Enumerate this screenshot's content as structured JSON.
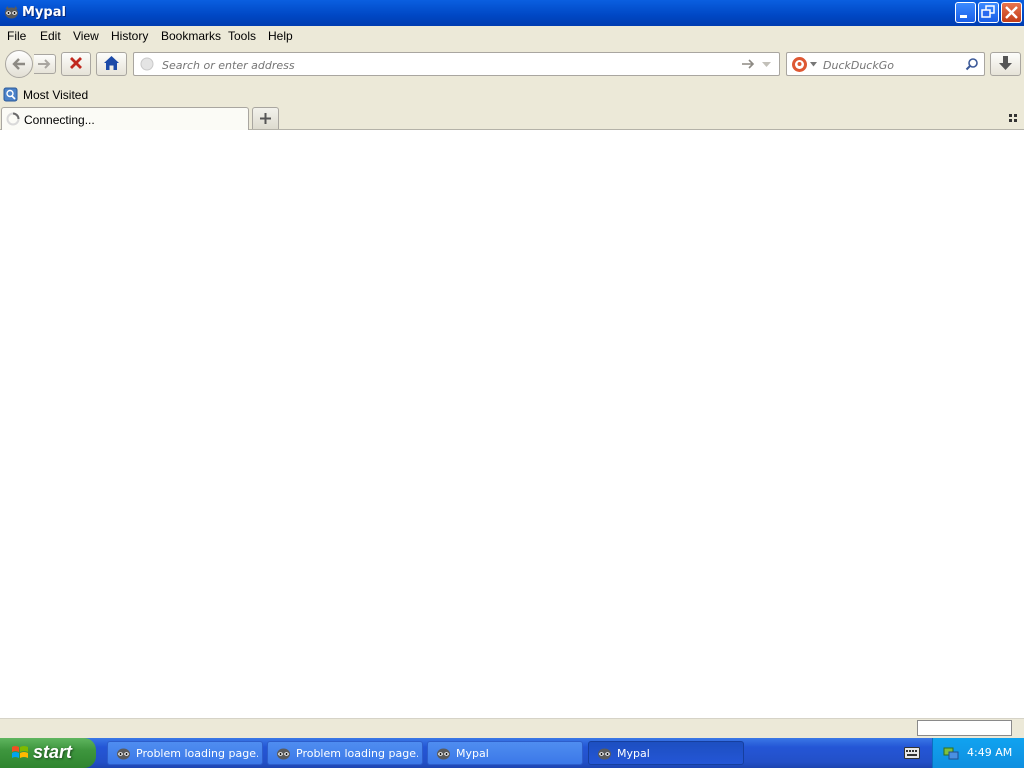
{
  "window": {
    "title": "Mypal",
    "icon": "raccoon-app-icon",
    "controls": {
      "minimize": "minimize-icon",
      "restore": "restore-icon",
      "close": "close-icon"
    }
  },
  "menubar": {
    "items": [
      {
        "label": "File"
      },
      {
        "label": "Edit"
      },
      {
        "label": "View"
      },
      {
        "label": "History"
      },
      {
        "label": "Bookmarks"
      },
      {
        "label": "Tools"
      },
      {
        "label": "Help"
      }
    ]
  },
  "toolbar": {
    "back_icon": "back-arrow-icon",
    "forward_icon": "forward-arrow-icon",
    "stop_icon": "stop-x-icon",
    "home_icon": "home-icon",
    "url_placeholder": "Search or enter address",
    "go_icon": "go-arrow-icon",
    "history_dropdown_icon": "dropdown-triangle-icon",
    "search_engine": "DuckDuckGo",
    "search_placeholder": "DuckDuckGo",
    "search_icon": "magnifier-icon",
    "downloads_icon": "download-arrow-icon"
  },
  "bookmarks": {
    "items": [
      {
        "label": "Most Visited",
        "icon": "bookmarks-folder-icon"
      }
    ]
  },
  "tabs": {
    "items": [
      {
        "label": "Connecting...",
        "icon": "loading-spinner-icon"
      }
    ],
    "new_tab_icon": "plus-icon",
    "list_all_icon": "grid-icon"
  },
  "taskbar": {
    "start_label": "start",
    "tasks": [
      {
        "label": "Problem loading page..."
      },
      {
        "label": "Problem loading page..."
      },
      {
        "label": "Mypal"
      },
      {
        "label": "Mypal"
      }
    ],
    "clock": "4:49 AM"
  },
  "colors": {
    "titlebar": "#0047c4",
    "chrome": "#ece9d8",
    "start_green": "#3e963e",
    "taskbar_blue": "#2456d6",
    "stop_red": "#c0281e",
    "home_blue": "#1c4aa8"
  }
}
